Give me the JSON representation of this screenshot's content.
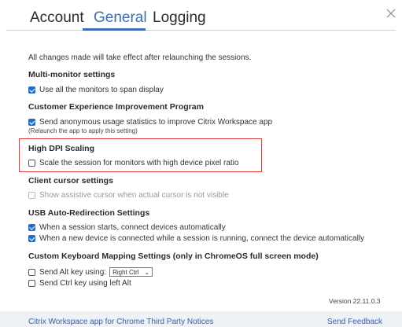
{
  "tabs": [
    {
      "label": "Account"
    },
    {
      "label": "General"
    },
    {
      "label": "Logging"
    }
  ],
  "active_tab": "General",
  "close_icon": "close-icon",
  "note": "All changes made will take effect after relaunching the sessions.",
  "sections": {
    "multi_monitor": {
      "heading": "Multi-monitor settings",
      "option": "Use all the monitors to span display",
      "checked": true
    },
    "ceip": {
      "heading": "Customer Experience Improvement Program",
      "option": "Send anonymous usage statistics to improve Citrix Workspace app",
      "subnote": "(Relaunch the app to apply this setting)",
      "checked": true
    },
    "high_dpi": {
      "heading": "High DPI Scaling",
      "option": "Scale the session for monitors with high device pixel ratio",
      "checked": false
    },
    "client_cursor": {
      "heading": "Client cursor settings",
      "option": "Show assistive cursor when actual cursor is not visible",
      "checked": false,
      "disabled": true
    },
    "usb": {
      "heading": "USB Auto-Redirection Settings",
      "options": [
        {
          "label": "When a session starts, connect devices automatically",
          "checked": true
        },
        {
          "label": "When a new device is connected while a session is running, connect the device automatically",
          "checked": true
        }
      ]
    },
    "keyboard": {
      "heading": "Custom Keyboard Mapping Settings (only in ChromeOS full screen mode)",
      "alt_label": "Send Alt key using:",
      "alt_select_value": "Right Ctrl",
      "alt_checked": false,
      "ctrl_label": "Send Ctrl key using left Alt",
      "ctrl_checked": false
    }
  },
  "version": "Version 22.11.0.3",
  "footer": {
    "third_party": "Citrix Workspace app for Chrome Third Party Notices",
    "feedback": "Send Feedback"
  },
  "colors": {
    "accent": "#3a6db8",
    "checkbox": "#1a6fd0",
    "highlight_border": "#e03a3a",
    "footer_bg": "#eef1f5",
    "link": "#2f64b8"
  }
}
